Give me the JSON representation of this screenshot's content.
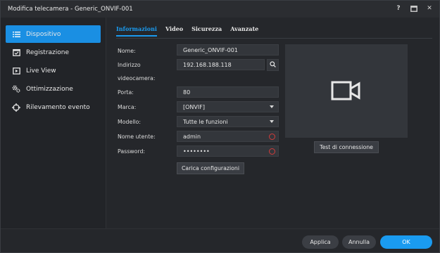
{
  "window": {
    "title": "Modifica telecamera - Generic_ONVIF-001"
  },
  "titlebar_controls": {
    "help": "?",
    "maximize": "maximize-icon",
    "close": "✕"
  },
  "sidebar": {
    "items": [
      {
        "label": "Dispositivo",
        "icon": "list-icon",
        "active": true
      },
      {
        "label": "Registrazione",
        "icon": "calendar-icon",
        "active": false
      },
      {
        "label": "Live View",
        "icon": "play-icon",
        "active": false
      },
      {
        "label": "Ottimizzazione",
        "icon": "gears-icon",
        "active": false
      },
      {
        "label": "Rilevamento evento",
        "icon": "crosshair-icon",
        "active": false
      }
    ]
  },
  "tabs": [
    {
      "label": "Informazioni",
      "active": true
    },
    {
      "label": "Video",
      "active": false
    },
    {
      "label": "Sicurezza",
      "active": false
    },
    {
      "label": "Avanzate",
      "active": false
    }
  ],
  "form": {
    "name_label": "Nome:",
    "name_value": "Generic_ONVIF-001",
    "address_label_1": "Indirizzo",
    "address_label_2": "videocamera:",
    "address_value": "192.168.188.118",
    "port_label": "Porta:",
    "port_value": "80",
    "brand_label": "Marca:",
    "brand_value": "[ONVIF]",
    "model_label": "Modello:",
    "model_value": "Tutte le funzioni",
    "user_label": "Nome utente:",
    "user_value": "admin",
    "password_label": "Password:",
    "password_value": "••••••••",
    "load_config_label": "Carica configurazioni"
  },
  "preview": {
    "test_label": "Test di connessione",
    "icon": "video-camera-icon"
  },
  "footer": {
    "apply_label": "Applica",
    "cancel_label": "Annulla",
    "ok_label": "OK"
  },
  "colors": {
    "accent": "#1a9bf0",
    "background": "#25272b",
    "field": "#33363b",
    "warning": "#d23b3b"
  }
}
